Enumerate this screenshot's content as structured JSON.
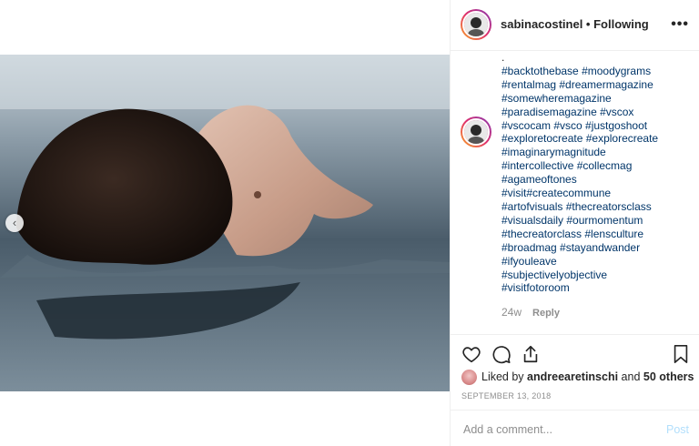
{
  "post": {
    "username": "sabinacostinel",
    "separator": " • ",
    "follow_state": "Following",
    "more_label": "•••"
  },
  "caption": {
    "dot": ".",
    "lines": [
      "#backtothebase #moodygrams",
      "#rentalmag #dreamermagazine",
      "#somewheremagazine",
      "#paradisemagazine #vscox",
      "#vscocam #vsco #justgoshoot",
      "#exploretocreate #explorecreate",
      "#imaginarymagnitude",
      "#intercollective #collecmag",
      "#agameoftones",
      "#visit#createcommune",
      "#artofvisuals #thecreatorsclass",
      "#visualsdaily #ourmomentum",
      "#thecreatorclass #lensculture",
      "#broadmag #stayandwander",
      "#ifyouleave",
      "#subjectivelyobjective",
      "#visitfotoroom"
    ],
    "age": "24w",
    "reply_label": "Reply"
  },
  "likes": {
    "prefix": "Liked by ",
    "user": "andreearetinschi",
    "middle": " and ",
    "others": "50 others"
  },
  "date": "SEPTEMBER 13, 2018",
  "comment": {
    "placeholder": "Add a comment...",
    "post_label": "Post"
  },
  "colors": {
    "hashtag": "#003569",
    "muted": "#8e8e8e",
    "post_disabled": "#b2dffc",
    "text": "#262626"
  },
  "icons": {
    "like": "heart-icon",
    "comment": "comment-icon",
    "share": "share-icon",
    "save": "bookmark-icon",
    "carousel_prev": "chevron-left-icon"
  }
}
